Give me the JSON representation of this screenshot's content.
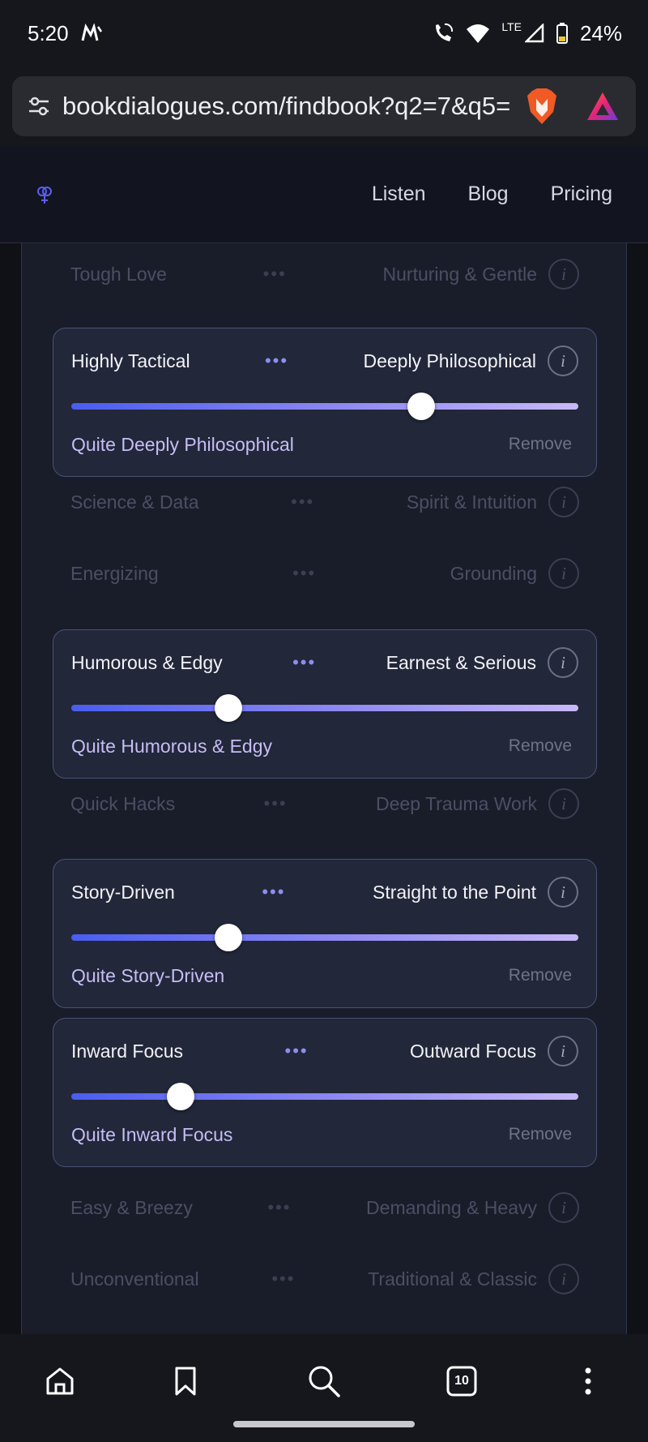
{
  "status_bar": {
    "time": "5:20",
    "network": "LTE",
    "battery": "24%"
  },
  "browser": {
    "url": "bookdialogues.com/findbook?q2=7&q5="
  },
  "site_nav": {
    "items": [
      "Listen",
      "Blog",
      "Pricing"
    ]
  },
  "preferences": [
    {
      "left": "Tough Love",
      "right": "Nurturing & Gentle",
      "active": false
    },
    {
      "left": "Highly Tactical",
      "right": "Deeply Philosophical",
      "active": true,
      "value": 0.69,
      "status": "Quite Deeply Philosophical",
      "remove": "Remove"
    },
    {
      "left": "Science & Data",
      "right": "Spirit & Intuition",
      "active": false
    },
    {
      "left": "Energizing",
      "right": "Grounding",
      "active": false
    },
    {
      "left": "Humorous & Edgy",
      "right": "Earnest & Serious",
      "active": true,
      "value": 0.31,
      "status": "Quite Humorous & Edgy",
      "remove": "Remove"
    },
    {
      "left": "Quick Hacks",
      "right": "Deep Trauma Work",
      "active": false
    },
    {
      "left": "Story-Driven",
      "right": "Straight to the Point",
      "active": true,
      "value": 0.31,
      "status": "Quite Story-Driven",
      "remove": "Remove"
    },
    {
      "left": "Inward Focus",
      "right": "Outward Focus",
      "active": true,
      "value": 0.215,
      "status": "Quite Inward Focus",
      "remove": "Remove"
    },
    {
      "left": "Easy & Breezy",
      "right": "Demanding & Heavy",
      "active": false
    },
    {
      "left": "Unconventional",
      "right": "Traditional & Classic",
      "active": false
    }
  ],
  "info_glyph": "i",
  "dots_glyph": "•••",
  "bottom_nav": {
    "tabs_count": "10",
    "icons": [
      "home-icon",
      "bookmark-icon",
      "search-icon",
      "tabs-icon",
      "more-icon"
    ]
  },
  "colors": {
    "accent_start": "#4a5df0",
    "accent_end": "#c8b8f8",
    "status_text": "#c5bdf5"
  }
}
